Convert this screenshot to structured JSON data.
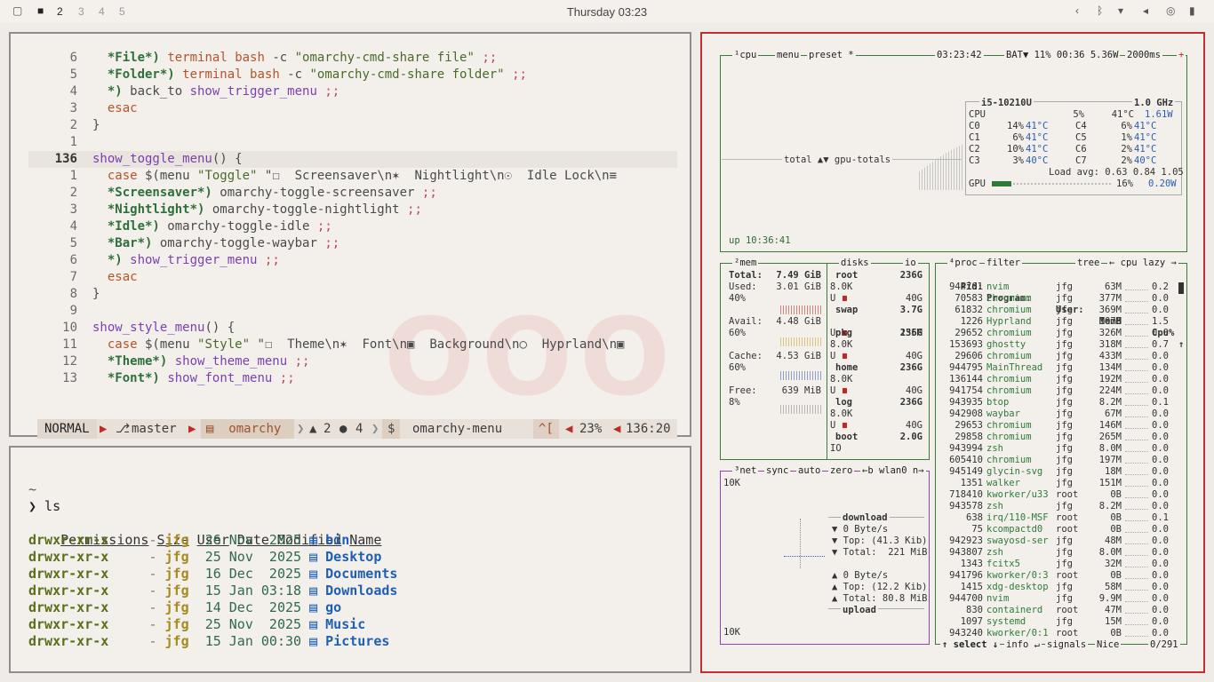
{
  "topbar": {
    "workspaces": [
      "2",
      "3",
      "4",
      "5"
    ],
    "clock": "Thursday 03:23"
  },
  "nvim": {
    "lines": [
      {
        "num": "6",
        "code": "  *File*) terminal bash -c \"omarchy-cmd-share file\" ;;"
      },
      {
        "num": "5",
        "code": "  *Folder*) terminal bash -c \"omarchy-cmd-share folder\" ;;"
      },
      {
        "num": "4",
        "code": "  *) back_to show_trigger_menu ;;"
      },
      {
        "num": "3",
        "code": "  esac"
      },
      {
        "num": "2",
        "code": "}"
      },
      {
        "num": "1",
        "code": ""
      },
      {
        "num": "136",
        "code": "show_toggle_menu() {"
      },
      {
        "num": "1",
        "code": "  case $(menu \"Toggle\" \"☐  Screensaver\\n✶  Nightlight\\n☉  Idle Lock\\n≡"
      },
      {
        "num": "2",
        "code": "  *Screensaver*) omarchy-toggle-screensaver ;;"
      },
      {
        "num": "3",
        "code": "  *Nightlight*) omarchy-toggle-nightlight ;;"
      },
      {
        "num": "4",
        "code": "  *Idle*) omarchy-toggle-idle ;;"
      },
      {
        "num": "5",
        "code": "  *Bar*) omarchy-toggle-waybar ;;"
      },
      {
        "num": "6",
        "code": "  *) show_trigger_menu ;;"
      },
      {
        "num": "7",
        "code": "  esac"
      },
      {
        "num": "8",
        "code": "}"
      },
      {
        "num": "9",
        "code": ""
      },
      {
        "num": "10",
        "code": "show_style_menu() {"
      },
      {
        "num": "11",
        "code": "  case $(menu \"Style\" \"☐  Theme\\n✶  Font\\n▣  Background\\n○  Hyprland\\n▣"
      },
      {
        "num": "12",
        "code": "  *Theme*) show_theme_menu ;;"
      },
      {
        "num": "13",
        "code": "  *Font*) show_font_menu ;;"
      }
    ],
    "status": {
      "mode": "NORMAL",
      "branch": "master",
      "project": "omarchy",
      "warnings": "2",
      "infos": "4",
      "file": "omarchy-menu",
      "keys": "^[",
      "percent": "23%",
      "position": "136:20"
    }
  },
  "terminal": {
    "tilde": "~",
    "prompt": "❯ ls",
    "headers": [
      "Permissions",
      "Size",
      "User",
      "Date Modified",
      "Name"
    ],
    "rows": [
      {
        "perm": "drwxr-xr-x",
        "size": "-",
        "user": "jfg",
        "date": "26 Nov  2025",
        "name": "bin"
      },
      {
        "perm": "drwxr-xr-x",
        "size": "-",
        "user": "jfg",
        "date": "25 Nov  2025",
        "name": "Desktop"
      },
      {
        "perm": "drwxr-xr-x",
        "size": "-",
        "user": "jfg",
        "date": "16 Dec  2025",
        "name": "Documents"
      },
      {
        "perm": "drwxr-xr-x",
        "size": "-",
        "user": "jfg",
        "date": "15 Jan 03:18",
        "name": "Downloads"
      },
      {
        "perm": "drwxr-xr-x",
        "size": "-",
        "user": "jfg",
        "date": "14 Dec  2025",
        "name": "go"
      },
      {
        "perm": "drwxr-xr-x",
        "size": "-",
        "user": "jfg",
        "date": "25 Nov  2025",
        "name": "Music"
      },
      {
        "perm": "drwxr-xr-x",
        "size": "-",
        "user": "jfg",
        "date": "15 Jan 00:30",
        "name": "Pictures"
      }
    ]
  },
  "btop": {
    "cpu_title": "¹cpu",
    "menu": "menu",
    "preset": "preset *",
    "time": "03:23:42",
    "bat": "BAT▼ 11% 00:36 5.36W",
    "interval": "2000ms",
    "total_label": "total ▲▼ gpu-totals",
    "uptime": "up 10:36:41",
    "cpu_model": "i5-10210U",
    "cpu_freq": "1.0 GHz",
    "cpu_rows": [
      {
        "name": "CPU",
        "pct": "5%",
        "temp": "41°C",
        "extra": "1.61W"
      },
      {
        "name": "C0",
        "pct": "14%",
        "temp": "41°C",
        "name2": "C4",
        "pct2": "6%",
        "temp2": "41°C"
      },
      {
        "name": "C1",
        "pct": "6%",
        "temp": "41°C",
        "name2": "C5",
        "pct2": "1%",
        "temp2": "41°C"
      },
      {
        "name": "C2",
        "pct": "10%",
        "temp": "41°C",
        "name2": "C6",
        "pct2": "2%",
        "temp2": "41°C"
      },
      {
        "name": "C3",
        "pct": "3%",
        "temp": "40°C",
        "name2": "C7",
        "pct2": "2%",
        "temp2": "40°C"
      }
    ],
    "load_avg": "Load avg: 0.63 0.84 1.05",
    "gpu": {
      "name": "GPU",
      "pct": "16%",
      "power": "0.20W"
    },
    "mem": {
      "title": "²mem",
      "total_label": "Total:",
      "total": "7.49 GiB",
      "used_label": "Used:",
      "used": "3.01 GiB",
      "used_pct": "40%",
      "avail_label": "Avail:",
      "avail": "4.48 GiB",
      "avail_pct": "60%",
      "cache_label": "Cache:",
      "cache": "4.53 GiB",
      "cache_pct": "60%",
      "free_label": "Free:",
      "free": "639 MiB",
      "free_pct": "8%"
    },
    "disks": {
      "title": "disks",
      "io": "io",
      "items": [
        {
          "name": "root",
          "size": "236G",
          "io": "8.0K",
          "u": "40G"
        },
        {
          "name": "swap",
          "size": "3.7G",
          "io": "",
          "u": "155M"
        },
        {
          "name": "pkg",
          "size": "236G",
          "io": "8.0K",
          "u": "40G"
        },
        {
          "name": "home",
          "size": "236G",
          "io": "8.0K",
          "u": "40G"
        },
        {
          "name": "log",
          "size": "236G",
          "io": "8.0K",
          "u": "40G"
        },
        {
          "name": "boot",
          "size": "2.0G",
          "io": "IO",
          "u": ""
        }
      ]
    },
    "net": {
      "title": "³net",
      "sync": "sync",
      "auto": "auto",
      "zero": "zero",
      "iface": "←b wlan0 n→",
      "top_scale": "10K",
      "bottom_scale": "10K",
      "download": "download",
      "dl_rate": "▼ 0 Byte/s",
      "dl_top": "▼ Top: (41.3 Kib)",
      "dl_total": "▼ Total:  221 MiB",
      "ul_rate": "▲ 0 Byte/s",
      "ul_top": "▲ Top: (12.2 Kib)",
      "ul_total": "▲ Total: 80.8 MiB",
      "upload": "upload"
    },
    "proc": {
      "title": "⁴proc",
      "filter": "filter",
      "tree": "tree",
      "sort": "← cpu lazy →",
      "headers": {
        "pid": "Pid:",
        "program": "Program:",
        "user": "User:",
        "mem": "MemB",
        "cpu": "Cpu%"
      },
      "rows": [
        {
          "pid": "944701",
          "prog": "nvim",
          "user": "jfg",
          "mem": "63M",
          "cpu": "0.2"
        },
        {
          "pid": "70583",
          "prog": "chromium",
          "user": "jfg",
          "mem": "377M",
          "cpu": "0.0"
        },
        {
          "pid": "61832",
          "prog": "chromium",
          "user": "jfg",
          "mem": "369M",
          "cpu": "0.0"
        },
        {
          "pid": "1226",
          "prog": "Hyprland",
          "user": "jfg",
          "mem": "107M",
          "cpu": "1.5"
        },
        {
          "pid": "29652",
          "prog": "chromium",
          "user": "jfg",
          "mem": "326M",
          "cpu": "0.0"
        },
        {
          "pid": "153693",
          "prog": "ghostty",
          "user": "jfg",
          "mem": "318M",
          "cpu": "0.7"
        },
        {
          "pid": "29606",
          "prog": "chromium",
          "user": "jfg",
          "mem": "433M",
          "cpu": "0.0"
        },
        {
          "pid": "944795",
          "prog": "MainThread",
          "user": "jfg",
          "mem": "134M",
          "cpu": "0.0"
        },
        {
          "pid": "136144",
          "prog": "chromium",
          "user": "jfg",
          "mem": "192M",
          "cpu": "0.0"
        },
        {
          "pid": "941754",
          "prog": "chromium",
          "user": "jfg",
          "mem": "224M",
          "cpu": "0.0"
        },
        {
          "pid": "943935",
          "prog": "btop",
          "user": "jfg",
          "mem": "8.2M",
          "cpu": "0.1"
        },
        {
          "pid": "942908",
          "prog": "waybar",
          "user": "jfg",
          "mem": "67M",
          "cpu": "0.0"
        },
        {
          "pid": "29653",
          "prog": "chromium",
          "user": "jfg",
          "mem": "146M",
          "cpu": "0.0"
        },
        {
          "pid": "29858",
          "prog": "chromium",
          "user": "jfg",
          "mem": "265M",
          "cpu": "0.0"
        },
        {
          "pid": "943994",
          "prog": "zsh",
          "user": "jfg",
          "mem": "8.0M",
          "cpu": "0.0"
        },
        {
          "pid": "605410",
          "prog": "chromium",
          "user": "jfg",
          "mem": "197M",
          "cpu": "0.0"
        },
        {
          "pid": "945149",
          "prog": "glycin-svg",
          "user": "jfg",
          "mem": "18M",
          "cpu": "0.0"
        },
        {
          "pid": "1351",
          "prog": "walker",
          "user": "jfg",
          "mem": "151M",
          "cpu": "0.0"
        },
        {
          "pid": "718410",
          "prog": "kworker/u33",
          "user": "root",
          "mem": "0B",
          "cpu": "0.0"
        },
        {
          "pid": "943578",
          "prog": "zsh",
          "user": "jfg",
          "mem": "8.2M",
          "cpu": "0.0"
        },
        {
          "pid": "638",
          "prog": "irq/110-MSF",
          "user": "root",
          "mem": "0B",
          "cpu": "0.1"
        },
        {
          "pid": "75",
          "prog": "kcompactd0",
          "user": "root",
          "mem": "0B",
          "cpu": "0.0"
        },
        {
          "pid": "942923",
          "prog": "swayosd-ser",
          "user": "jfg",
          "mem": "48M",
          "cpu": "0.0"
        },
        {
          "pid": "943807",
          "prog": "zsh",
          "user": "jfg",
          "mem": "8.0M",
          "cpu": "0.0"
        },
        {
          "pid": "1343",
          "prog": "fcitx5",
          "user": "jfg",
          "mem": "32M",
          "cpu": "0.0"
        },
        {
          "pid": "941796",
          "prog": "kworker/0:3",
          "user": "root",
          "mem": "0B",
          "cpu": "0.0"
        },
        {
          "pid": "1415",
          "prog": "xdg-desktop",
          "user": "jfg",
          "mem": "58M",
          "cpu": "0.0"
        },
        {
          "pid": "944700",
          "prog": "nvim",
          "user": "jfg",
          "mem": "9.9M",
          "cpu": "0.0"
        },
        {
          "pid": "830",
          "prog": "containerd",
          "user": "root",
          "mem": "47M",
          "cpu": "0.0"
        },
        {
          "pid": "1097",
          "prog": "systemd",
          "user": "jfg",
          "mem": "15M",
          "cpu": "0.0"
        },
        {
          "pid": "943240",
          "prog": "kworker/0:1",
          "user": "root",
          "mem": "0B",
          "cpu": "0.0"
        }
      ],
      "footer": {
        "select": "↑ select ↓",
        "info": "info ↵",
        "signals": "signals",
        "nice": "Nice",
        "count": "0/291"
      }
    }
  },
  "colors": {
    "accent": "#c03030",
    "frame": "#8e8e8e",
    "btop_green": "#3b7a3b",
    "btop_purple": "#8e44ad"
  }
}
